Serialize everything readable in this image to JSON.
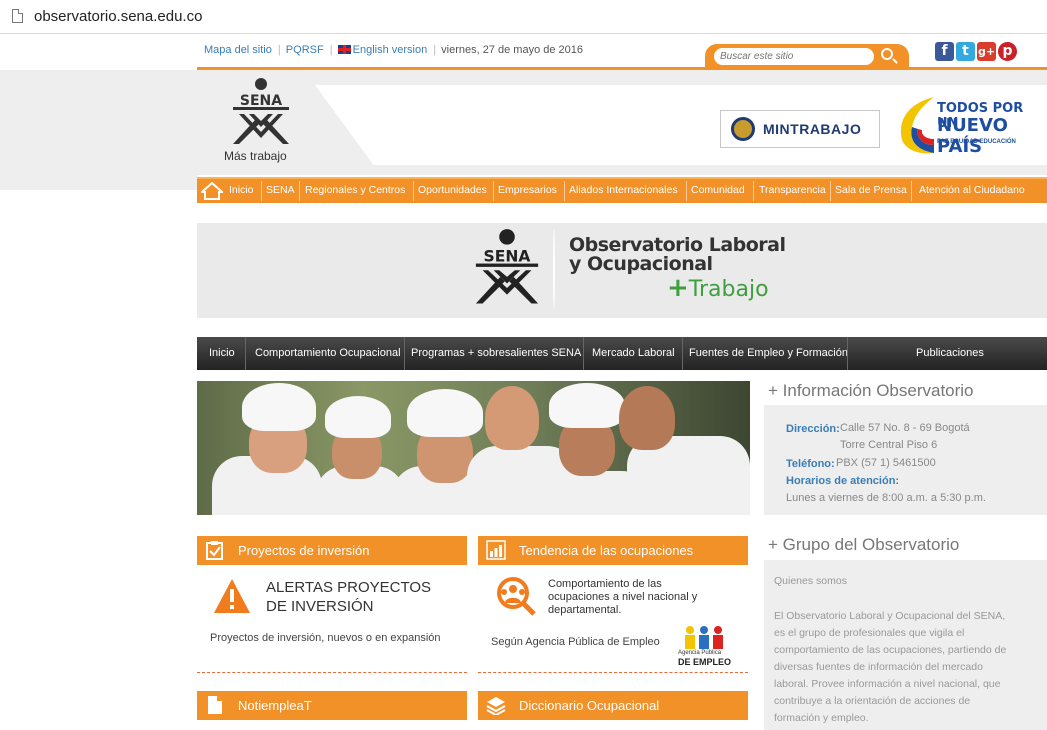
{
  "browser": {
    "url": "observatorio.sena.edu.co"
  },
  "topbar": {
    "mapa": "Mapa del sitio",
    "pqrsf": "PQRSF",
    "english": "English version",
    "date": "viernes, 27 de mayo de 2016",
    "search_placeholder": "Buscar este sitio",
    "social": [
      "f",
      "t",
      "g+",
      "p"
    ]
  },
  "header": {
    "sena": "SENA",
    "mas_trabajo": "Más trabajo",
    "mintrabajo": "MINTRABAJO",
    "todos_1": "TODOS POR UN",
    "todos_2": "NUEVO PAÍS",
    "todos_3": "PAZ  EQUIDAD  EDUCACIÓN"
  },
  "nav1": [
    "Inicio",
    "SENA",
    "Regionales y Centros",
    "Oportunidades",
    "Empresarios",
    "Aliados Internacionales",
    "Comunidad",
    "Transparencia",
    "Sala de Prensa",
    "Atención al Ciudadano"
  ],
  "banner": {
    "line1": "Observatorio Laboral",
    "line2": "y Ocupacional",
    "plus": "+",
    "trabajo": "Trabajo"
  },
  "nav2": [
    "Inicio",
    "Comportamiento Ocupacional",
    "Programas + sobresalientes SENA",
    "Mercado Laboral",
    "Fuentes de Empleo y Formación",
    "Publicaciones"
  ],
  "info": {
    "title": "+ Información Observatorio",
    "dir_label": "Dirección:",
    "dir_1": "Calle 57 No. 8 - 69 Bogotá",
    "dir_2": "Torre Central Piso 6",
    "tel_label": "Teléfono:",
    "tel": "PBX (57 1) 5461500",
    "hor_label": "Horarios de atención:",
    "hor": "Lunes a viernes de 8:00 a.m. a 5:30 p.m."
  },
  "grupo": {
    "title": "+ Grupo del Observatorio",
    "quienes": "Quienes somos",
    "lines": [
      "El Observatorio Laboral y Ocupacional del SENA,",
      "es el grupo de profesionales que vigila el",
      "comportamiento de las ocupaciones, partiendo de",
      "diversas fuentes de información del mercado",
      "laboral. Provee información a nivel nacional, que",
      "contribuye a la orientación de acciones de",
      "formación y empleo."
    ]
  },
  "proyectos": {
    "bar": "Proyectos de inversión",
    "alert_1": "ALERTAS PROYECTOS",
    "alert_2": "DE INVERSIÓN",
    "desc": "Proyectos de inversión, nuevos o en expansión"
  },
  "tendencia": {
    "bar": "Tendencia de las ocupaciones",
    "l1": "Comportamiento de las",
    "l2": "ocupaciones a nivel nacional y",
    "l3": "departamental.",
    "agencia": "Según Agencia Pública de Empleo",
    "logo_small": "Agencia Pública",
    "logo_big": "DE EMPLEO"
  },
  "notiempleat": {
    "bar": "NotiempleaT"
  },
  "diccionario": {
    "bar": "Diccionario Ocupacional"
  }
}
